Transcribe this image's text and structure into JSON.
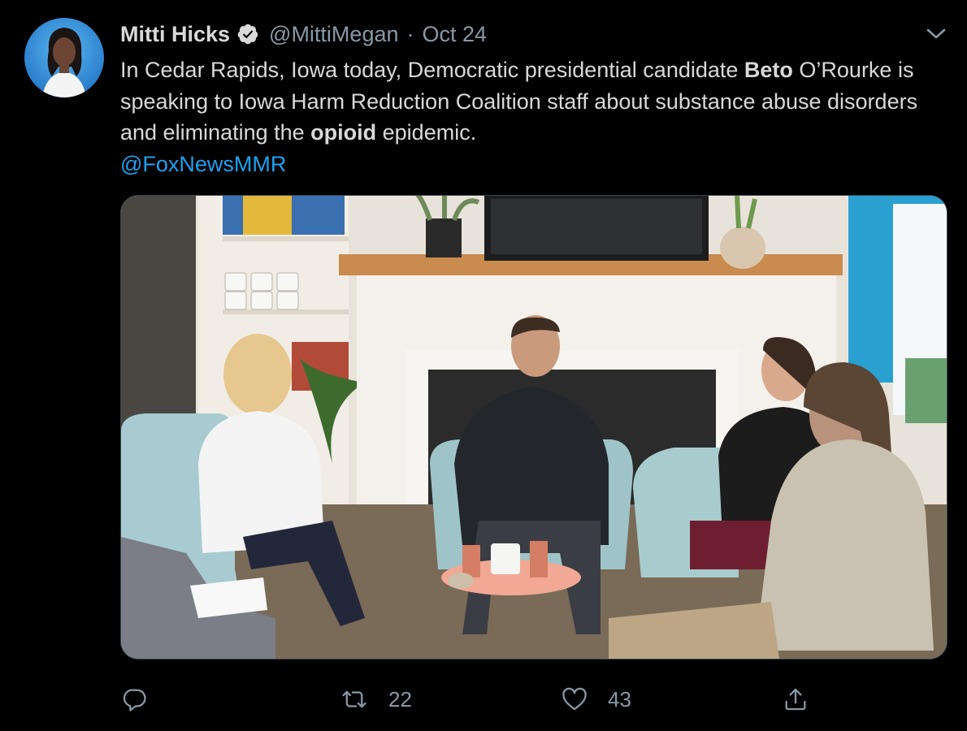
{
  "author": {
    "name": "Mitti Hicks",
    "handle": "@MittiMegan",
    "separator": "·",
    "date": "Oct 24",
    "verified": true
  },
  "tweet": {
    "text_part1": "In Cedar Rapids, Iowa today, Democratic presidential candidate ",
    "bold1": "Beto",
    "text_part2": " O’Rourke is speaking to Iowa Harm Reduction Coalition staff about substance abuse disorders and eliminating the ",
    "bold2": "opioid",
    "text_part3": " epidemic.",
    "mention": "@FoxNewsMMR"
  },
  "actions": {
    "reply_icon": "reply-icon",
    "retweet_count": "22",
    "like_count": "43",
    "share_icon": "share-icon"
  },
  "colors": {
    "background": "#000000",
    "text": "#d9d9d9",
    "secondary": "#8899a6",
    "link": "#1da1f2"
  }
}
